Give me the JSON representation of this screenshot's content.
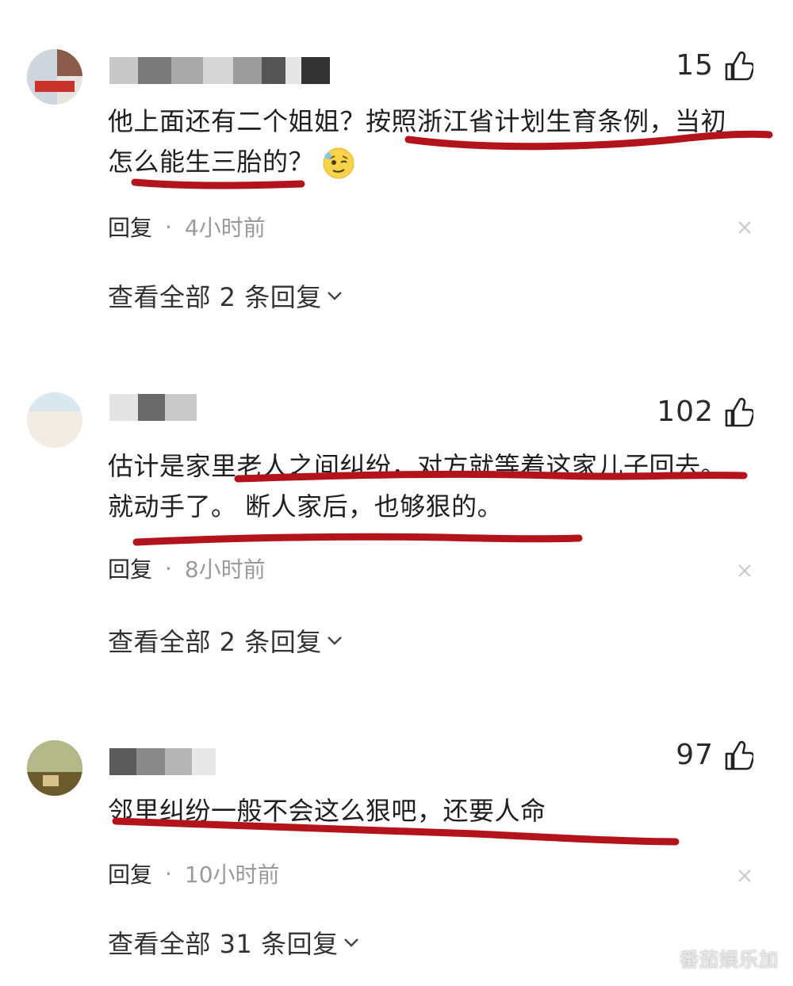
{
  "comments": [
    {
      "likes": "15",
      "text": "他上面还有二个姐姐？按照浙江省计划生育条例，当初怎么能生三胎的？",
      "reply_label": "回复",
      "separator": "·",
      "time": "4小时前",
      "view_replies": "查看全部 2 条回复"
    },
    {
      "likes": "102",
      "text": "估计是家里老人之间纠纷，对方就等着这家儿子回去。就动手了。 断人家后，也够狠的。",
      "reply_label": "回复",
      "separator": "·",
      "time": "8小时前",
      "view_replies": "查看全部 2 条回复"
    },
    {
      "likes": "97",
      "text": "邻里纠纷一般不会这么狠吧，还要人命",
      "reply_label": "回复",
      "separator": "·",
      "time": "10小时前",
      "view_replies": "查看全部 31 条回复"
    }
  ],
  "watermark": "番茄娱乐加",
  "colors": {
    "underline": "#b3141b",
    "text": "#1f1f1f",
    "muted": "#9a9a9a",
    "background": "#ffffff"
  },
  "icons": [
    "thumb-up-icon",
    "close-icon",
    "chevron-down-icon",
    "emoji-icon"
  ]
}
